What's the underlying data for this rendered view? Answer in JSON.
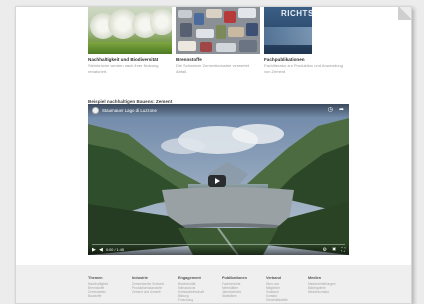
{
  "cards": [
    {
      "title": "Nachhaltigkeit und Biodiversität",
      "desc": "Steinbrüche werden nach ihrer Nutzung renaturiert."
    },
    {
      "title": "Brennstoffe",
      "desc": "Die Schweizer Zementindustrie verwertet Abfall."
    },
    {
      "title": "Fachpublikationen",
      "desc": "Fachliteratur zur Produktion und Anwendung von Zement."
    }
  ],
  "book_cover_text": "RICHTS",
  "section_heading": "Beispiel nachhaltigen Bauens: Zement",
  "video": {
    "title": "Staumauer Lago di Luzzone",
    "time": "0:00 / 1:45",
    "progress": 0.0
  },
  "footer": {
    "columns": [
      {
        "heading": "Themen",
        "links": [
          "Nachhaltigkeit",
          "Brennstoffe",
          "Zementarten",
          "Baustoffe"
        ]
      },
      {
        "heading": "Industrie",
        "links": [
          "Zementwerke Schweiz",
          "Produktionsstandorte",
          "Zement und Umwelt"
        ]
      },
      {
        "heading": "Engagement",
        "links": [
          "Biodiversität",
          "Klimaschutz",
          "Kreislaufwirtschaft",
          "Bildung",
          "Forschung"
        ]
      },
      {
        "heading": "Publikationen",
        "links": [
          "Fachberichte",
          "Merkblätter",
          "Jahresbericht",
          "Statistiken"
        ]
      },
      {
        "heading": "Verband",
        "links": [
          "Über uns",
          "Mitglieder",
          "Vorstand",
          "Kontakt",
          "Geschäftsstelle"
        ]
      },
      {
        "heading": "Medien",
        "links": [
          "Medienmitteilungen",
          "Bildergalerie",
          "Medienkontakt"
        ]
      }
    ]
  },
  "colors": {
    "accent": "#e62117",
    "footer_bg": "#efefef",
    "page_bg": "#ececec"
  }
}
